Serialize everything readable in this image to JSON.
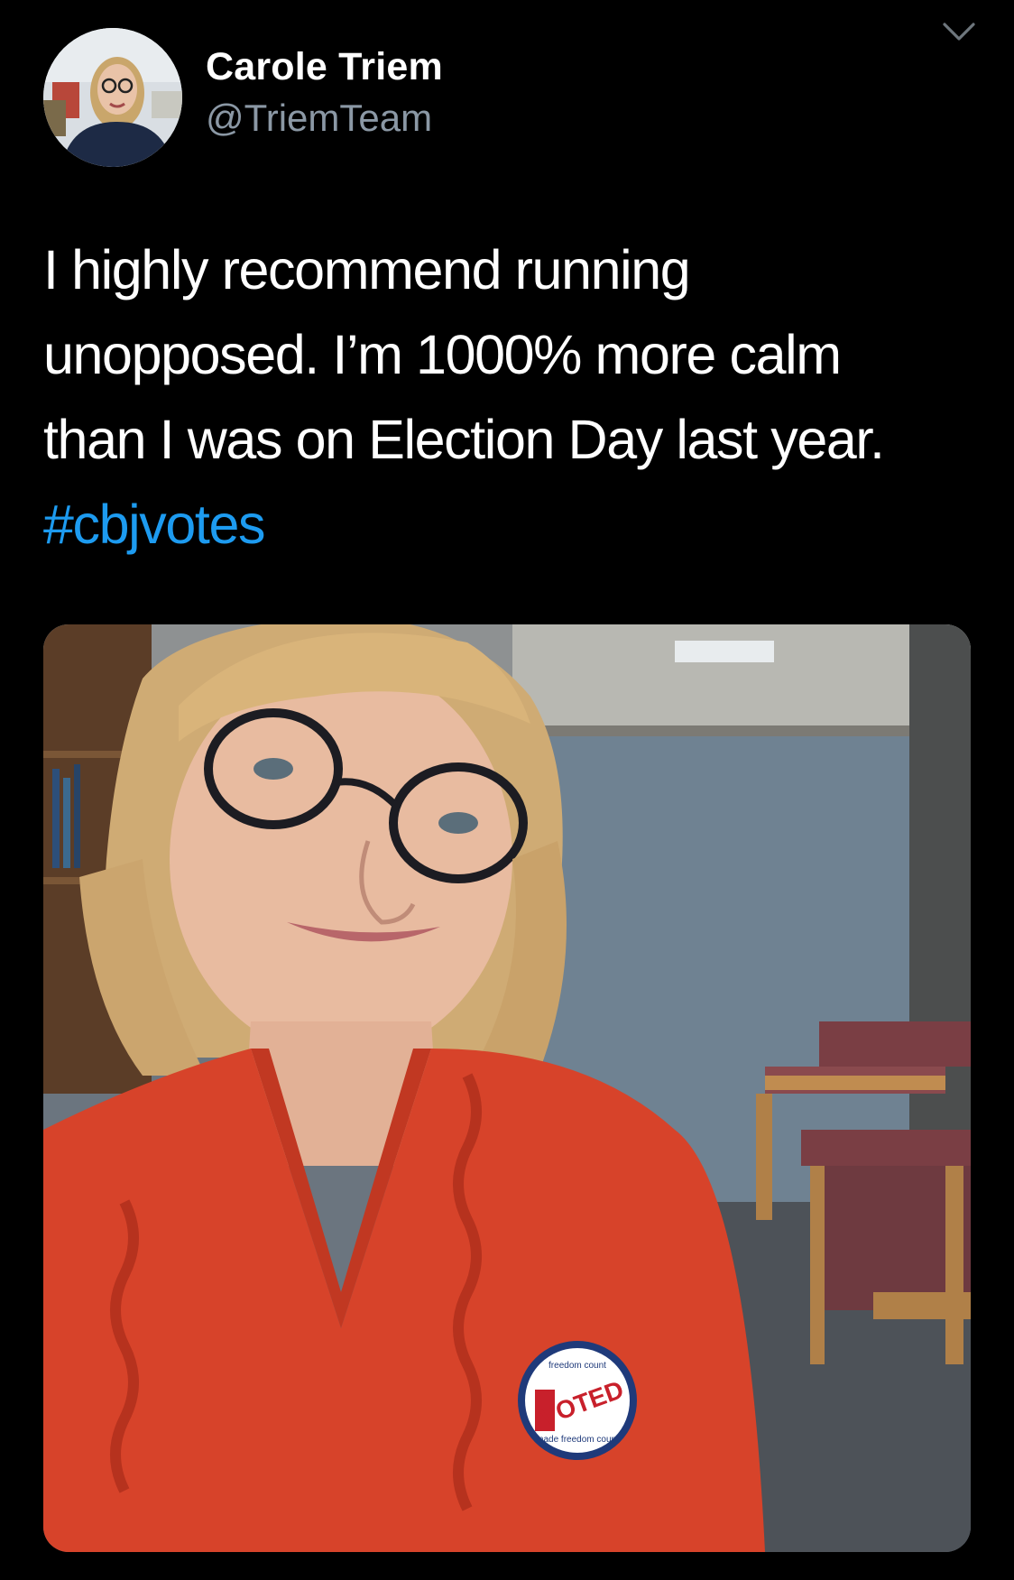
{
  "tweet": {
    "author": {
      "display_name": "Carole Triem",
      "handle": "@TriemTeam",
      "avatar_icon": "profile-photo"
    },
    "text_lines": [
      "I highly recommend running",
      "unopposed. I’m 1000% more calm",
      "than I was on Election Day last year."
    ],
    "hashtag": "#cbjvotes",
    "menu_icon": "chevron-down-icon",
    "media": {
      "sticker_text_main": "VOTED",
      "sticker_text_top": "freedom count",
      "sticker_text_bottom": "made freedom count"
    }
  },
  "colors": {
    "background": "#000000",
    "text": "#ffffff",
    "secondary_text": "#8b98a5",
    "link": "#1d9bf0"
  }
}
